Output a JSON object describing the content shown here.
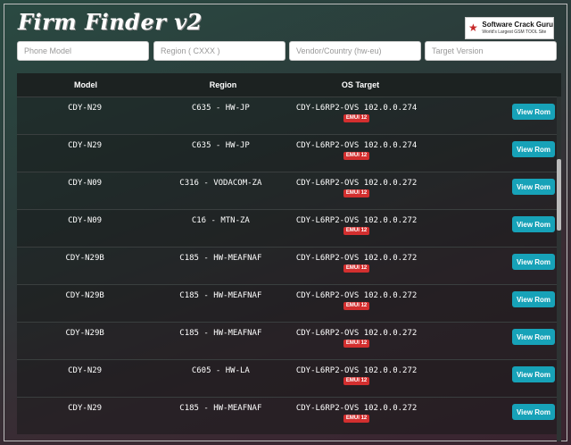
{
  "app": {
    "logo_text": "Firm Finder v2"
  },
  "brand": {
    "name": "Software Crack Guru",
    "tagline": "World's Largest GSM TOOL Site",
    "icon": "star-icon"
  },
  "search": {
    "phone_model_placeholder": "Phone Model",
    "region_placeholder": "Region ( CXXX )",
    "vendor_placeholder": "Vendor/Country (hw-eu)",
    "target_version_placeholder": "Target Version"
  },
  "table": {
    "headers": {
      "model": "Model",
      "region": "Region",
      "os_target": "OS Target"
    },
    "view_label": "View Rom",
    "rows": [
      {
        "model": "CDY-N29",
        "region": "C635 - HW-JP",
        "os": "CDY-L6RP2-OVS 102.0.0.274",
        "badge": "EMUI 12"
      },
      {
        "model": "CDY-N29",
        "region": "C635 - HW-JP",
        "os": "CDY-L6RP2-OVS 102.0.0.274",
        "badge": "EMUI 12"
      },
      {
        "model": "CDY-N09",
        "region": "C316 - VODACOM-ZA",
        "os": "CDY-L6RP2-OVS 102.0.0.272",
        "badge": "EMUI 12"
      },
      {
        "model": "CDY-N09",
        "region": "C16 - MTN-ZA",
        "os": "CDY-L6RP2-OVS 102.0.0.272",
        "badge": "EMUI 12"
      },
      {
        "model": "CDY-N29B",
        "region": "C185 - HW-MEAFNAF",
        "os": "CDY-L6RP2-OVS 102.0.0.272",
        "badge": "EMUI 12"
      },
      {
        "model": "CDY-N29B",
        "region": "C185 - HW-MEAFNAF",
        "os": "CDY-L6RP2-OVS 102.0.0.272",
        "badge": "EMUI 12"
      },
      {
        "model": "CDY-N29B",
        "region": "C185 - HW-MEAFNAF",
        "os": "CDY-L6RP2-OVS 102.0.0.272",
        "badge": "EMUI 12"
      },
      {
        "model": "CDY-N29",
        "region": "C605 - HW-LA",
        "os": "CDY-L6RP2-OVS 102.0.0.272",
        "badge": "EMUI 12"
      },
      {
        "model": "CDY-N29",
        "region": "C185 - HW-MEAFNAF",
        "os": "CDY-L6RP2-OVS 102.0.0.272",
        "badge": "EMUI 12"
      }
    ]
  },
  "colors": {
    "button": "#17a2b8",
    "badge": "#d32f2f",
    "header_bg": "#1c2221"
  }
}
